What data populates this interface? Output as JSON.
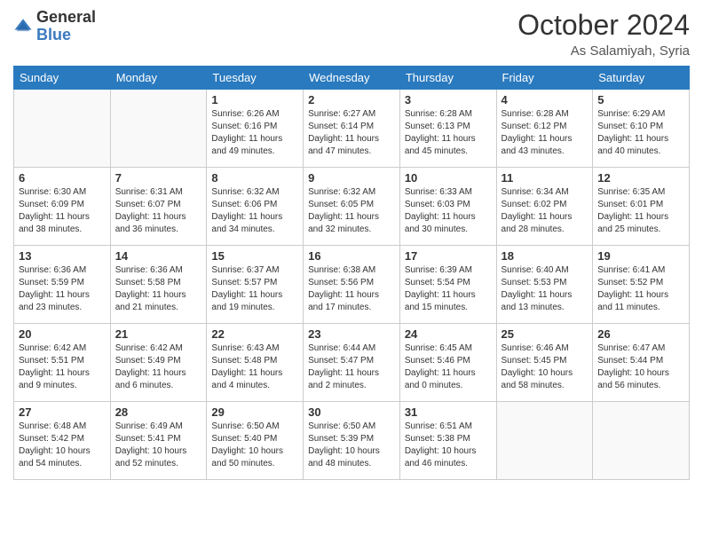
{
  "logo": {
    "general": "General",
    "blue": "Blue"
  },
  "header": {
    "month_year": "October 2024",
    "location": "As Salamiyah, Syria"
  },
  "weekdays": [
    "Sunday",
    "Monday",
    "Tuesday",
    "Wednesday",
    "Thursday",
    "Friday",
    "Saturday"
  ],
  "weeks": [
    [
      {
        "day": "",
        "sunrise": "",
        "sunset": "",
        "daylight": ""
      },
      {
        "day": "",
        "sunrise": "",
        "sunset": "",
        "daylight": ""
      },
      {
        "day": "1",
        "sunrise": "Sunrise: 6:26 AM",
        "sunset": "Sunset: 6:16 PM",
        "daylight": "Daylight: 11 hours and 49 minutes."
      },
      {
        "day": "2",
        "sunrise": "Sunrise: 6:27 AM",
        "sunset": "Sunset: 6:14 PM",
        "daylight": "Daylight: 11 hours and 47 minutes."
      },
      {
        "day": "3",
        "sunrise": "Sunrise: 6:28 AM",
        "sunset": "Sunset: 6:13 PM",
        "daylight": "Daylight: 11 hours and 45 minutes."
      },
      {
        "day": "4",
        "sunrise": "Sunrise: 6:28 AM",
        "sunset": "Sunset: 6:12 PM",
        "daylight": "Daylight: 11 hours and 43 minutes."
      },
      {
        "day": "5",
        "sunrise": "Sunrise: 6:29 AM",
        "sunset": "Sunset: 6:10 PM",
        "daylight": "Daylight: 11 hours and 40 minutes."
      }
    ],
    [
      {
        "day": "6",
        "sunrise": "Sunrise: 6:30 AM",
        "sunset": "Sunset: 6:09 PM",
        "daylight": "Daylight: 11 hours and 38 minutes."
      },
      {
        "day": "7",
        "sunrise": "Sunrise: 6:31 AM",
        "sunset": "Sunset: 6:07 PM",
        "daylight": "Daylight: 11 hours and 36 minutes."
      },
      {
        "day": "8",
        "sunrise": "Sunrise: 6:32 AM",
        "sunset": "Sunset: 6:06 PM",
        "daylight": "Daylight: 11 hours and 34 minutes."
      },
      {
        "day": "9",
        "sunrise": "Sunrise: 6:32 AM",
        "sunset": "Sunset: 6:05 PM",
        "daylight": "Daylight: 11 hours and 32 minutes."
      },
      {
        "day": "10",
        "sunrise": "Sunrise: 6:33 AM",
        "sunset": "Sunset: 6:03 PM",
        "daylight": "Daylight: 11 hours and 30 minutes."
      },
      {
        "day": "11",
        "sunrise": "Sunrise: 6:34 AM",
        "sunset": "Sunset: 6:02 PM",
        "daylight": "Daylight: 11 hours and 28 minutes."
      },
      {
        "day": "12",
        "sunrise": "Sunrise: 6:35 AM",
        "sunset": "Sunset: 6:01 PM",
        "daylight": "Daylight: 11 hours and 25 minutes."
      }
    ],
    [
      {
        "day": "13",
        "sunrise": "Sunrise: 6:36 AM",
        "sunset": "Sunset: 5:59 PM",
        "daylight": "Daylight: 11 hours and 23 minutes."
      },
      {
        "day": "14",
        "sunrise": "Sunrise: 6:36 AM",
        "sunset": "Sunset: 5:58 PM",
        "daylight": "Daylight: 11 hours and 21 minutes."
      },
      {
        "day": "15",
        "sunrise": "Sunrise: 6:37 AM",
        "sunset": "Sunset: 5:57 PM",
        "daylight": "Daylight: 11 hours and 19 minutes."
      },
      {
        "day": "16",
        "sunrise": "Sunrise: 6:38 AM",
        "sunset": "Sunset: 5:56 PM",
        "daylight": "Daylight: 11 hours and 17 minutes."
      },
      {
        "day": "17",
        "sunrise": "Sunrise: 6:39 AM",
        "sunset": "Sunset: 5:54 PM",
        "daylight": "Daylight: 11 hours and 15 minutes."
      },
      {
        "day": "18",
        "sunrise": "Sunrise: 6:40 AM",
        "sunset": "Sunset: 5:53 PM",
        "daylight": "Daylight: 11 hours and 13 minutes."
      },
      {
        "day": "19",
        "sunrise": "Sunrise: 6:41 AM",
        "sunset": "Sunset: 5:52 PM",
        "daylight": "Daylight: 11 hours and 11 minutes."
      }
    ],
    [
      {
        "day": "20",
        "sunrise": "Sunrise: 6:42 AM",
        "sunset": "Sunset: 5:51 PM",
        "daylight": "Daylight: 11 hours and 9 minutes."
      },
      {
        "day": "21",
        "sunrise": "Sunrise: 6:42 AM",
        "sunset": "Sunset: 5:49 PM",
        "daylight": "Daylight: 11 hours and 6 minutes."
      },
      {
        "day": "22",
        "sunrise": "Sunrise: 6:43 AM",
        "sunset": "Sunset: 5:48 PM",
        "daylight": "Daylight: 11 hours and 4 minutes."
      },
      {
        "day": "23",
        "sunrise": "Sunrise: 6:44 AM",
        "sunset": "Sunset: 5:47 PM",
        "daylight": "Daylight: 11 hours and 2 minutes."
      },
      {
        "day": "24",
        "sunrise": "Sunrise: 6:45 AM",
        "sunset": "Sunset: 5:46 PM",
        "daylight": "Daylight: 11 hours and 0 minutes."
      },
      {
        "day": "25",
        "sunrise": "Sunrise: 6:46 AM",
        "sunset": "Sunset: 5:45 PM",
        "daylight": "Daylight: 10 hours and 58 minutes."
      },
      {
        "day": "26",
        "sunrise": "Sunrise: 6:47 AM",
        "sunset": "Sunset: 5:44 PM",
        "daylight": "Daylight: 10 hours and 56 minutes."
      }
    ],
    [
      {
        "day": "27",
        "sunrise": "Sunrise: 6:48 AM",
        "sunset": "Sunset: 5:42 PM",
        "daylight": "Daylight: 10 hours and 54 minutes."
      },
      {
        "day": "28",
        "sunrise": "Sunrise: 6:49 AM",
        "sunset": "Sunset: 5:41 PM",
        "daylight": "Daylight: 10 hours and 52 minutes."
      },
      {
        "day": "29",
        "sunrise": "Sunrise: 6:50 AM",
        "sunset": "Sunset: 5:40 PM",
        "daylight": "Daylight: 10 hours and 50 minutes."
      },
      {
        "day": "30",
        "sunrise": "Sunrise: 6:50 AM",
        "sunset": "Sunset: 5:39 PM",
        "daylight": "Daylight: 10 hours and 48 minutes."
      },
      {
        "day": "31",
        "sunrise": "Sunrise: 6:51 AM",
        "sunset": "Sunset: 5:38 PM",
        "daylight": "Daylight: 10 hours and 46 minutes."
      },
      {
        "day": "",
        "sunrise": "",
        "sunset": "",
        "daylight": ""
      },
      {
        "day": "",
        "sunrise": "",
        "sunset": "",
        "daylight": ""
      }
    ]
  ]
}
